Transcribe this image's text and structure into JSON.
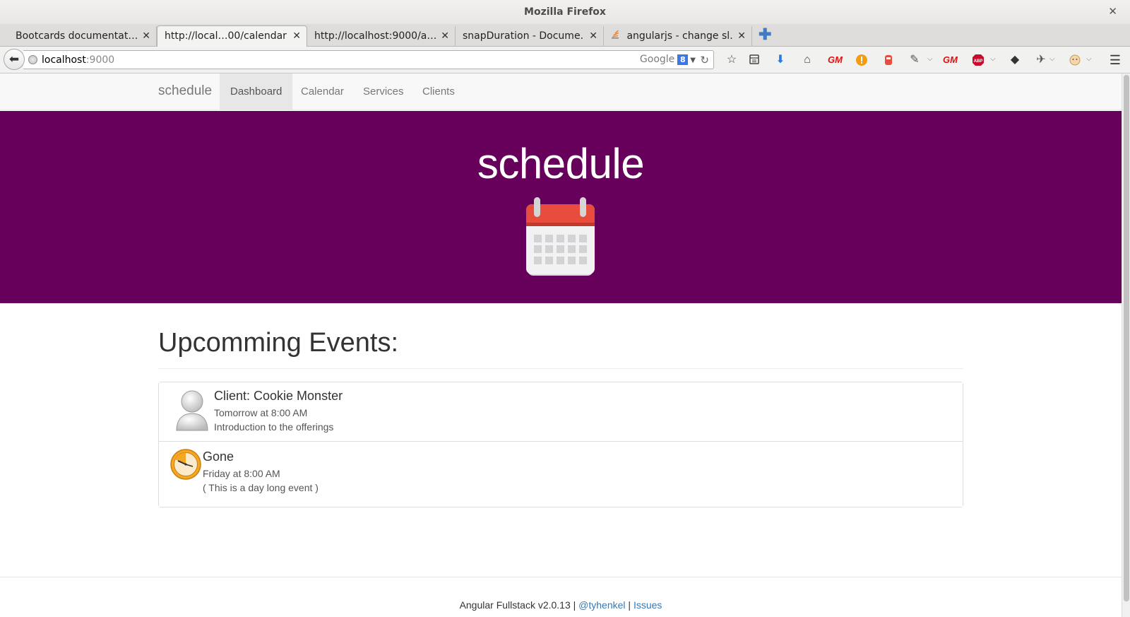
{
  "window": {
    "title": "Mozilla Firefox"
  },
  "tabs": [
    {
      "label": "Bootcards documentat…",
      "active": false
    },
    {
      "label": "http://local…00/calendar",
      "active": true
    },
    {
      "label": "http://localhost:9000/a…",
      "active": false
    },
    {
      "label": "snapDuration - Docume…",
      "active": false
    },
    {
      "label": "angularjs - change sl…",
      "active": false
    }
  ],
  "address_bar": {
    "host": "localhost",
    "port": ":9000",
    "search_engine": "Google",
    "search_badge": "8"
  },
  "toolbar_icons": [
    "star-icon",
    "reading-list-icon",
    "download-icon",
    "home-icon",
    "greasemonkey-icon",
    "alert-icon",
    "addon-icon",
    "eyedropper-icon",
    "greasemonkey-icon",
    "adblock-plus-icon",
    "addon-icon",
    "addon-icon",
    "addon-icon",
    "hamburger-menu-icon"
  ],
  "site": {
    "brand": "schedule",
    "nav": [
      "Dashboard",
      "Calendar",
      "Services",
      "Clients"
    ],
    "active_nav": "Dashboard"
  },
  "hero": {
    "title": "schedule"
  },
  "events": {
    "heading": "Upcomming Events:",
    "items": [
      {
        "icon": "user-avatar-icon",
        "title": "Client: Cookie Monster",
        "time": "Tomorrow at 8:00 AM",
        "description": "Introduction to the offerings"
      },
      {
        "icon": "clock-icon",
        "title": "Gone",
        "time": "Friday at 8:00 AM",
        "description": "( This is a day long event )"
      }
    ]
  },
  "footer": {
    "text": "Angular Fullstack v2.0.13 |",
    "link1": "@tyhenkel",
    "separator": "|",
    "link2": "Issues"
  },
  "colors": {
    "hero_bg": "#67005a",
    "link": "#337ab7"
  }
}
